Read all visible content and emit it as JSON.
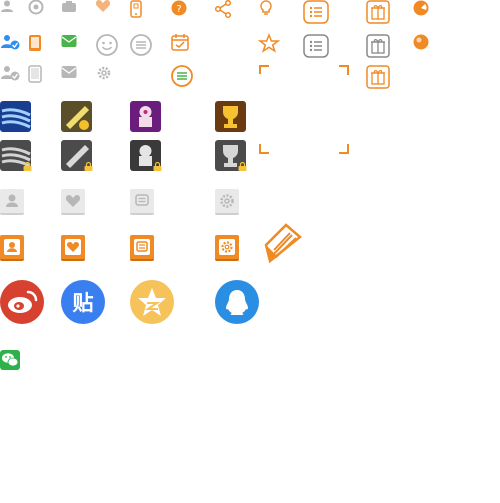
{
  "title": "",
  "colors": {
    "gray": "#b7b7b7",
    "orange": "#f08a24",
    "green": "#4ab44a",
    "blue": "#2f8ff0",
    "weibo_red": "#d7412f",
    "tieba_blue": "#3a7ff0",
    "qzone_yellow": "#f6c25a",
    "qq_blue": "#2a8fe3",
    "wechat_green": "#2eb14a"
  },
  "logos": {
    "tieba": "贴"
  },
  "icons": [
    "user-icon",
    "eye-icon",
    "camera-icon",
    "heart-icon",
    "phone-icon",
    "chat-icon",
    "share-icon",
    "lightbulb-icon",
    "list-icon",
    "gift-icon",
    "pie-icon",
    "verified-user-icon",
    "tablet-icon",
    "mail-icon",
    "smile-icon",
    "menu-circle-icon",
    "calendar-check-icon",
    "star-icon",
    "crop-frame-icon",
    "medal-icon",
    "weibo-icon",
    "tieba-icon",
    "qzone-icon",
    "qq-icon",
    "wechat-icon",
    "pen-icon",
    "lock-icon",
    "gear-icon"
  ]
}
